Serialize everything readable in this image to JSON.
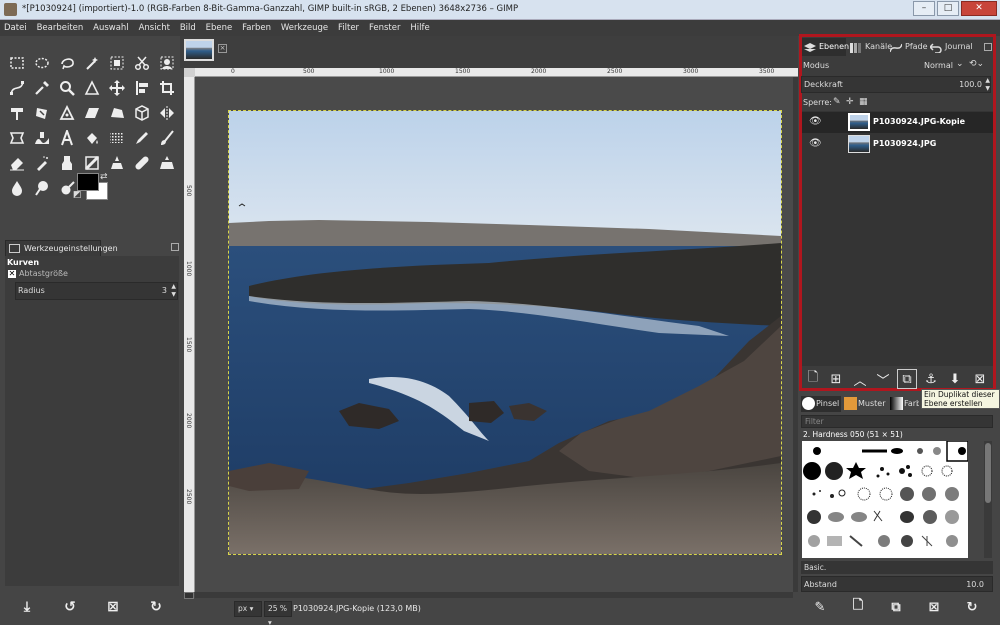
{
  "window": {
    "title": "*[P1030924] (importiert)-1.0 (RGB-Farben 8-Bit-Gamma-Ganzzahl, GIMP built-in sRGB, 2 Ebenen) 3648x2736 – GIMP",
    "minimize": "–",
    "maximize": "□",
    "close": "✕"
  },
  "menu": [
    "Datei",
    "Bearbeiten",
    "Auswahl",
    "Ansicht",
    "Bild",
    "Ebene",
    "Farben",
    "Werkzeuge",
    "Filter",
    "Fenster",
    "Hilfe"
  ],
  "toolbox": {
    "tool_options_tab": "Werkzeugeinstellungen",
    "tool_name": "Kurven",
    "sample_merged_label": "Abtastgröße",
    "radius_label": "Radius",
    "radius_value": "3"
  },
  "rulers": {
    "top": [
      "0",
      "500",
      "1000",
      "1500",
      "2000",
      "2500",
      "3000",
      "3500"
    ],
    "left": [
      "500",
      "1000",
      "1500",
      "2000",
      "2500"
    ]
  },
  "status": {
    "unit": "px",
    "zoom": "25 %",
    "info": "P1030924.JPG-Kopie (123,0 MB)"
  },
  "layers_dock": {
    "tabs": [
      "Ebenen",
      "Kanäle",
      "Pfade",
      "Journal"
    ],
    "mode_label": "Modus",
    "mode_value": "Normal",
    "opacity_label": "Deckkraft",
    "opacity_value": "100.0",
    "lock_label": "Sperre:",
    "layers": [
      {
        "name": "P1030924.JPG-Kopie",
        "selected": true
      },
      {
        "name": "P1030924.JPG",
        "selected": false
      }
    ],
    "tooltip": "Ein Duplikat dieser Ebene erstellen und zum Ebenenstapel hinzufügen"
  },
  "brushes_dock": {
    "tabs": [
      "Pinsel",
      "Muster",
      "Farbverläufe"
    ],
    "filter_placeholder": "Filter",
    "brush_name": "2. Hardness 050 (51 × 51)",
    "preset": "Basic.",
    "spacing_label": "Abstand",
    "spacing_value": "10.0"
  },
  "colors": {
    "highlight_border": "#b0161e",
    "foreground": "#000000",
    "background": "#ffffff"
  }
}
